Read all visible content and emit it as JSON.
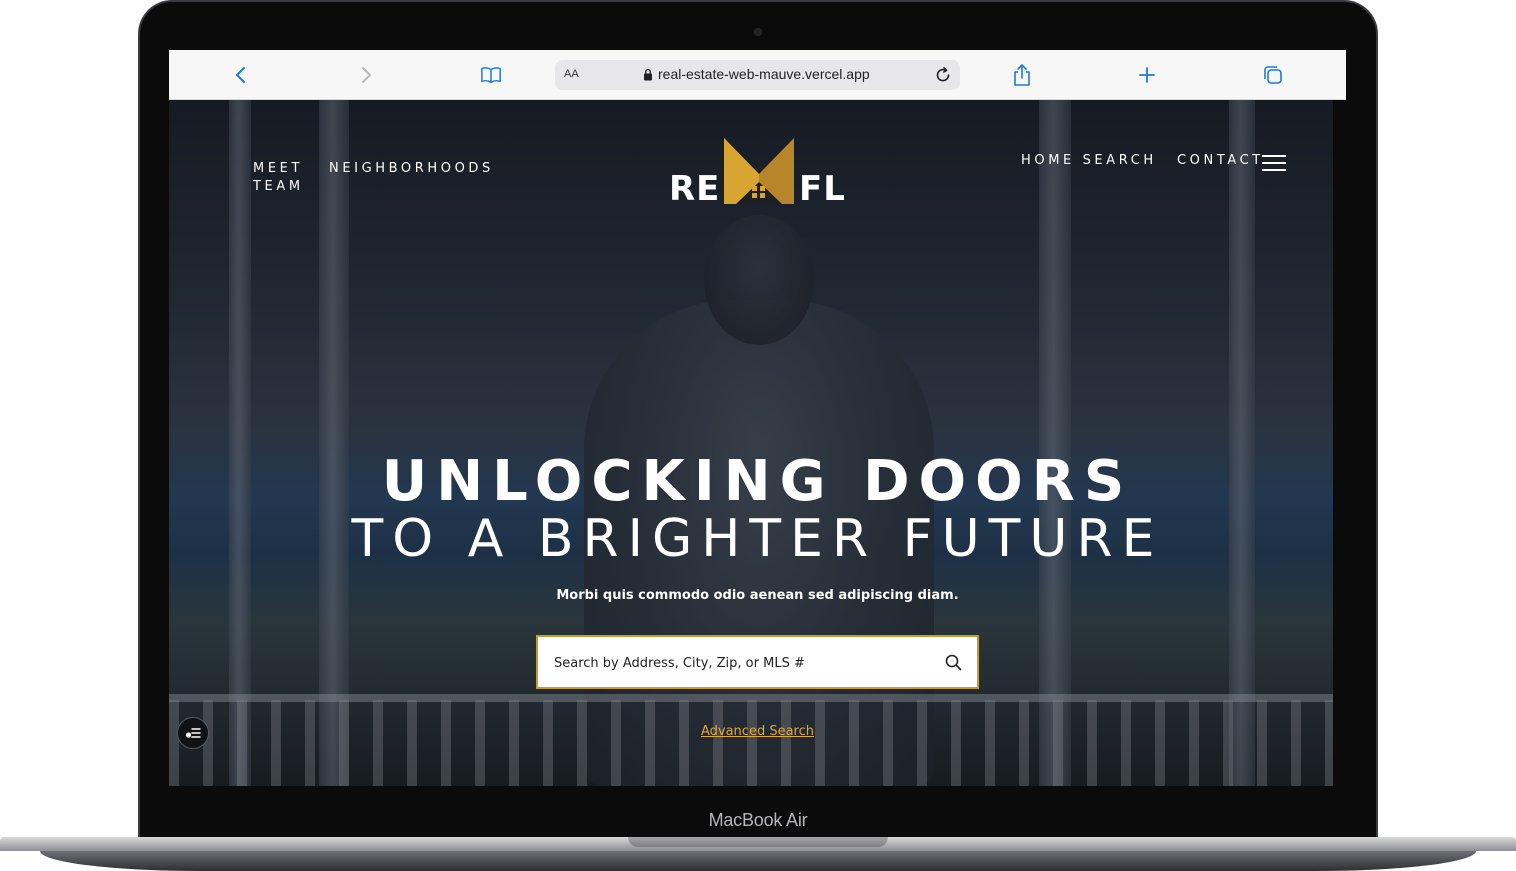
{
  "device": {
    "label": "MacBook Air"
  },
  "browser": {
    "text_size_label": "AA",
    "url": "real-estate-web-mauve.vercel.app",
    "icons": {
      "back": "chevron-left-icon",
      "forward": "chevron-right-icon",
      "bookmarks": "book-icon",
      "lock": "lock-icon",
      "reload": "reload-icon",
      "share": "share-icon",
      "new_tab": "plus-icon",
      "tabs": "tabs-icon"
    }
  },
  "site": {
    "nav_left": [
      {
        "label": "MEET\nTEAM"
      },
      {
        "label": "NEIGHBORHOODS"
      }
    ],
    "nav_right": [
      {
        "label": "HOME SEARCH"
      },
      {
        "label": "CONTACT"
      }
    ],
    "logo": {
      "left": "RE",
      "right": "FL",
      "accent_color": "#d9a531"
    },
    "hero": {
      "headline_1": "UNLOCKING DOORS",
      "headline_2": "TO A BRIGHTER FUTURE",
      "subtitle": "Morbi quis commodo odio aenean sed adipiscing diam."
    },
    "search": {
      "placeholder": "Search by Address, City, Zip, or MLS #",
      "value": "",
      "border_color": "#c99a2e"
    },
    "advanced_search_label": "Advanced Search",
    "accent_color": "#e0a93a"
  }
}
